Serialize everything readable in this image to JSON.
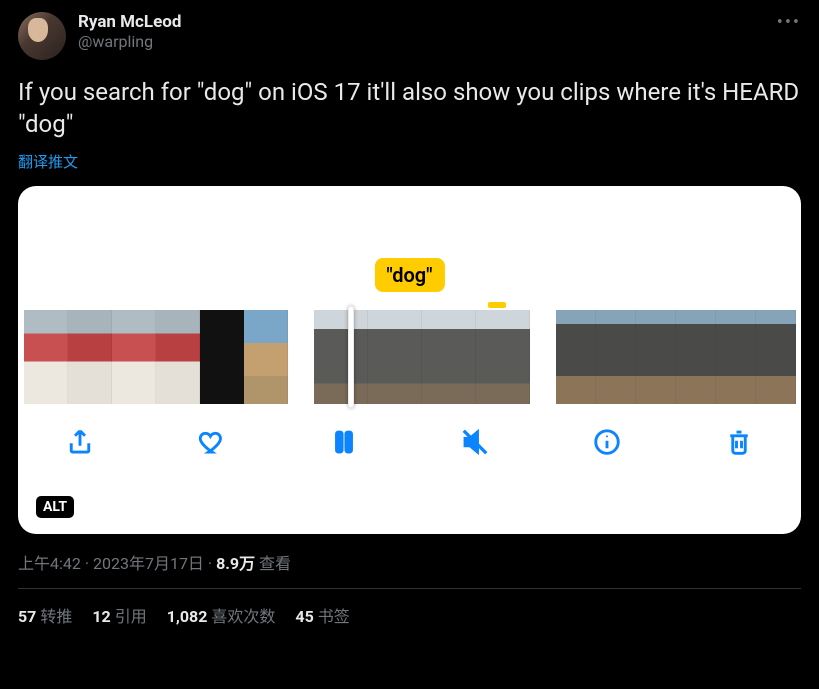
{
  "header": {
    "display_name": "Ryan McLeod",
    "handle": "@warpling"
  },
  "body": {
    "text": "If you search for \"dog\" on iOS 17 it'll also show you clips where it's HEARD \"dog\"",
    "translate_label": "翻译推文"
  },
  "media": {
    "chip_label": "\"dog\"",
    "alt_badge": "ALT",
    "toolbar": {
      "share": "share-icon",
      "like": "heart-icon",
      "pause": "pause-icon",
      "mute": "mute-icon",
      "info": "info-icon",
      "trash": "trash-icon"
    }
  },
  "meta": {
    "time": "上午4:42",
    "date": "2023年7月17日",
    "views_count": "8.9万",
    "views_label": "查看"
  },
  "stats": {
    "retweets": {
      "count": "57",
      "label": "转推"
    },
    "quotes": {
      "count": "12",
      "label": "引用"
    },
    "likes": {
      "count": "1,082",
      "label": "喜欢次数"
    },
    "bookmarks": {
      "count": "45",
      "label": "书签"
    }
  }
}
